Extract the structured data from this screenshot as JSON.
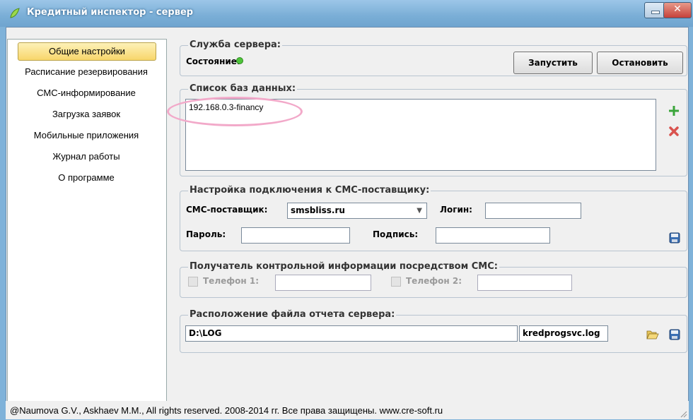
{
  "window": {
    "title": "Кредитный инспектор - сервер"
  },
  "sidebar": {
    "items": [
      {
        "label": "Общие настройки"
      },
      {
        "label": "Расписание резервирования"
      },
      {
        "label": "СМС-информирование"
      },
      {
        "label": "Загрузка заявок"
      },
      {
        "label": "Мобильные приложения"
      },
      {
        "label": "Журнал работы"
      },
      {
        "label": "О программе"
      }
    ]
  },
  "service": {
    "legend": "Служба сервера:",
    "state_label": "Состояние:",
    "start_label": "Запустить",
    "stop_label": "Остановить",
    "status_color": "#4fc43a"
  },
  "databases": {
    "legend": "Список баз данных:",
    "items": [
      "192.168.0.3-financy"
    ]
  },
  "sms": {
    "legend": "Настройка подключения к СМС-поставщику:",
    "provider_label": "СМС-поставщик:",
    "provider_value": "smsbliss.ru",
    "login_label": "Логин:",
    "login_value": "",
    "password_label": "Пароль:",
    "password_value": "",
    "signature_label": "Подпись:",
    "signature_value": ""
  },
  "recipient": {
    "legend": "Получатель контрольной информации посредством СМС:",
    "phone1_label": "Телефон 1:",
    "phone1_value": "",
    "phone2_label": "Телефон 2:",
    "phone2_value": ""
  },
  "report": {
    "legend": "Расположение файла отчета сервера:",
    "path_value": "D:\\LOG",
    "file_value": "kredprogsvc.log"
  },
  "status_bar": {
    "text": "@Naumova G.V., Askhaev M.M., All rights reserved. 2008-2014 гг. Все права защищены. www.cre-soft.ru"
  },
  "colors": {
    "accent": "#f8d66b",
    "title_bar": "#7aaed6",
    "add": "#3aa53a",
    "remove": "#d9534f"
  }
}
